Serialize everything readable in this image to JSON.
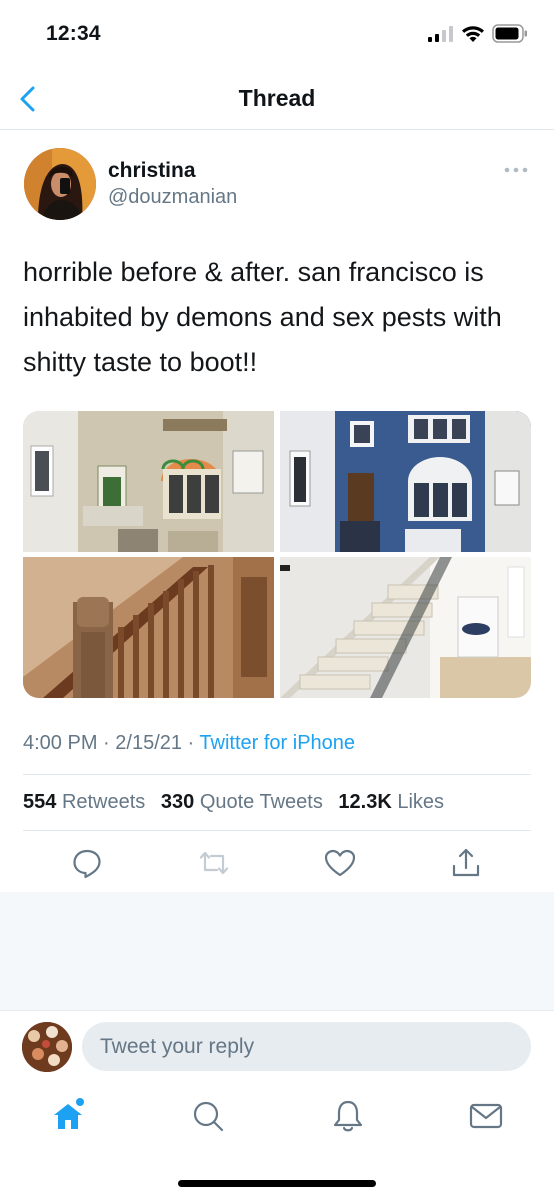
{
  "status_bar": {
    "time": "12:34"
  },
  "nav": {
    "title": "Thread"
  },
  "tweet": {
    "display_name": "christina",
    "handle": "@douzmanian",
    "text": "horrible before & after. san francisco is inhabited by demons and sex pests with shitty taste to boot!!",
    "time": "4:00 PM",
    "date": "2/15/21",
    "source": "Twitter for iPhone",
    "retweets_count": "554",
    "retweets_label": "Retweets",
    "quotes_count": "330",
    "quotes_label": "Quote Tweets",
    "likes_count": "12.3K",
    "likes_label": "Likes"
  },
  "actions": [
    "reply-icon",
    "retweet-icon",
    "like-icon",
    "share-icon"
  ],
  "reply": {
    "placeholder": "Tweet your reply"
  },
  "tabbar": [
    "home-icon",
    "search-icon",
    "notifications-icon",
    "messages-icon"
  ],
  "colors": {
    "accent": "#1da1f2",
    "secondary_text": "#657786",
    "divider": "#e1e8ed"
  }
}
